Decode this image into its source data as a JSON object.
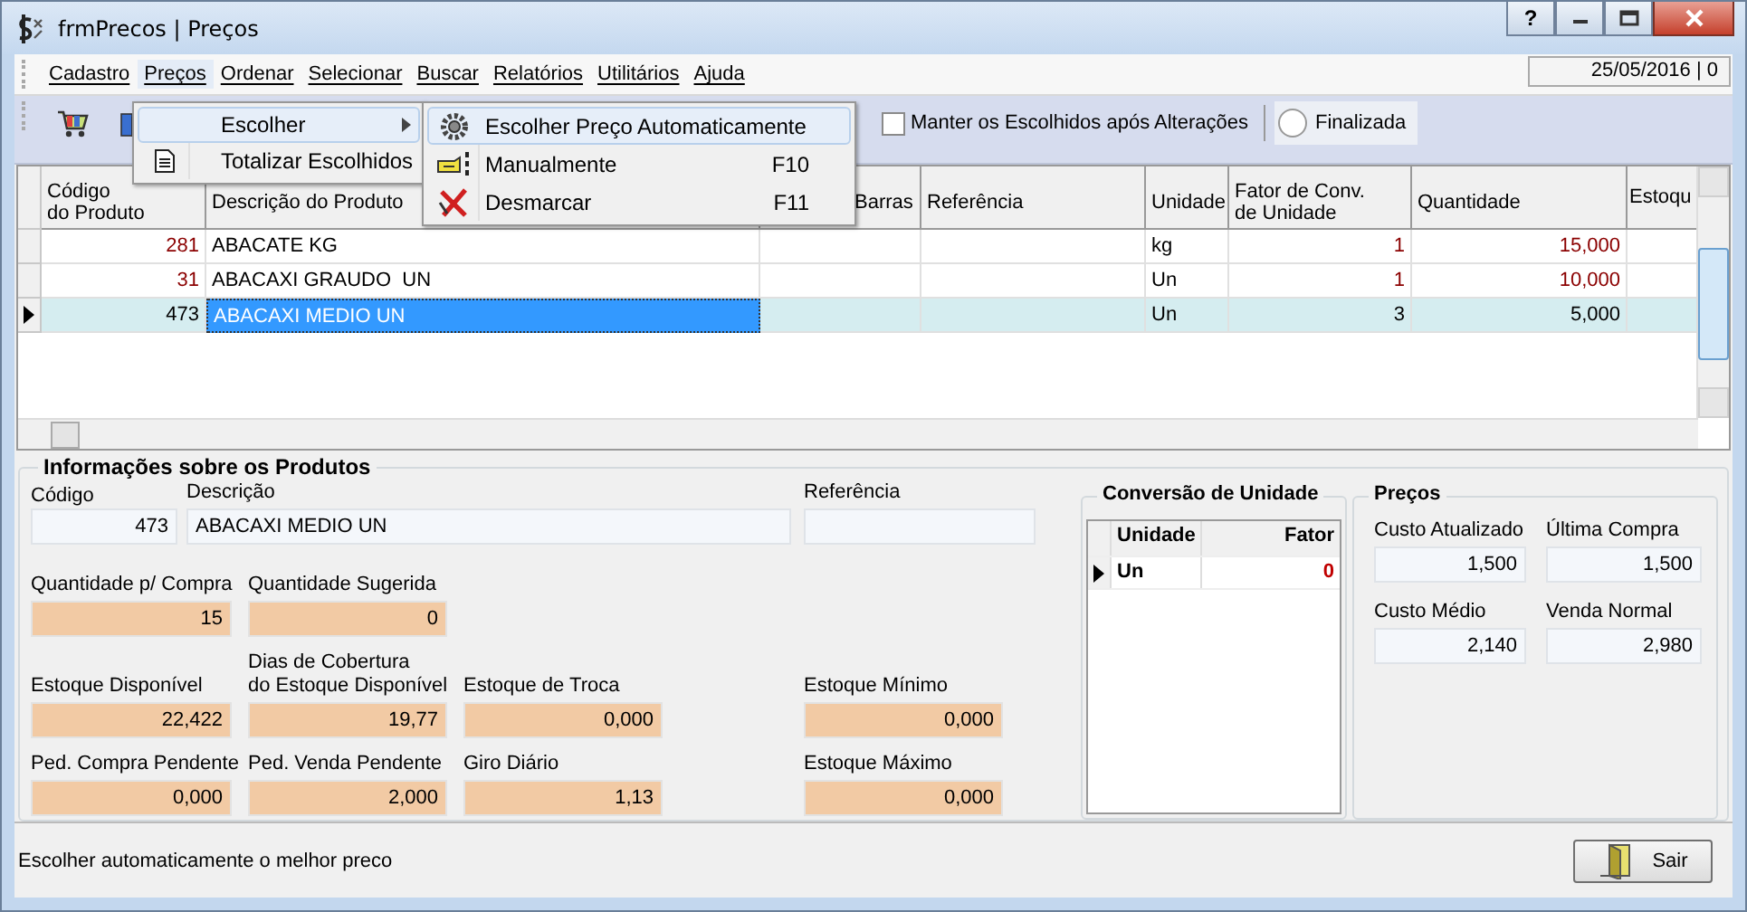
{
  "window": {
    "title": "frmPrecos | Preços",
    "help_button": "?"
  },
  "menu_bar": [
    {
      "label": "Cadastro",
      "selected": false
    },
    {
      "label": "Preços",
      "selected": true
    },
    {
      "label": "Ordenar",
      "selected": false
    },
    {
      "label": "Selecionar",
      "selected": false
    },
    {
      "label": "Buscar",
      "selected": false
    },
    {
      "label": "Relatórios",
      "selected": false
    },
    {
      "label": "Utilitários",
      "selected": false
    },
    {
      "label": "Ajuda",
      "selected": false
    }
  ],
  "date_panel": "25/05/2016 | 0",
  "toolbar": {
    "checkbox": {
      "label": "Manter os Escolhidos após Alterações",
      "checked": false
    },
    "radio": {
      "label": "Finalizada",
      "selected": false
    }
  },
  "grid": {
    "columns": [
      "Código\ndo Produto",
      "Descrição do Produto",
      "Barras",
      "Referência",
      "Unidade",
      "Fator de Conv.\nde Unidade",
      "Quantidade",
      "Estoqu"
    ],
    "rows": [
      {
        "code": "281",
        "description": "ABACATE KG",
        "unit": "kg",
        "factor": "1",
        "quantity": "15,000",
        "selected": false
      },
      {
        "code": "31",
        "description": "ABACAXI GRAUDO  UN",
        "unit": "Un",
        "factor": "1",
        "quantity": "10,000",
        "selected": false
      },
      {
        "code": "473",
        "description": "ABACAXI MEDIO UN",
        "unit": "Un",
        "factor": "3",
        "quantity": "5,000",
        "selected": true
      }
    ]
  },
  "menu": {
    "items": [
      {
        "label": "Escolher",
        "selected": true,
        "submenu": true
      },
      {
        "label": "Totalizar Escolhidos",
        "selected": false,
        "submenu": false
      }
    ]
  },
  "submenu": {
    "items": [
      {
        "label": "Escolher Preço Automaticamente",
        "selected": true
      },
      {
        "label": "Manualmente",
        "shortcut": "F10",
        "selected": false
      },
      {
        "label": "Desmarcar",
        "shortcut": "F11",
        "selected": false
      }
    ]
  },
  "product_info": {
    "title": "Informações sobre os Produtos",
    "fields": [
      {
        "label": "Código",
        "value": "473",
        "kind": "plain"
      },
      {
        "label": "Descrição",
        "value": "ABACAXI MEDIO UN",
        "kind": "plain"
      },
      {
        "label": "Referência",
        "kind": "plain"
      },
      {
        "label": "Quantidade p/ Compra",
        "value": "15",
        "kind": "highlight"
      },
      {
        "label": "Quantidade Sugerida",
        "value": "0",
        "kind": "highlight"
      },
      {
        "label": "Estoque Disponível",
        "value": "22,422",
        "kind": "highlight"
      },
      {
        "label": "Dias de Cobertura\ndo Estoque Disponível",
        "value": "19,77",
        "kind": "highlight"
      },
      {
        "label": "Estoque de Troca",
        "value": "0,000",
        "kind": "highlight"
      },
      {
        "label": "Estoque Mínimo",
        "value": "0,000",
        "kind": "highlight"
      },
      {
        "label": "Ped. Compra Pendente",
        "value": "0,000",
        "kind": "highlight"
      },
      {
        "label": "Ped. Venda Pendente",
        "value": "2,000",
        "kind": "highlight"
      },
      {
        "label": "Giro Diário",
        "value": "1,13",
        "kind": "highlight"
      },
      {
        "label": "Estoque Máximo",
        "value": "0,000",
        "kind": "highlight"
      }
    ]
  },
  "unit_conversion": {
    "title": "Conversão de Unidade",
    "columns": [
      "Unidade",
      "Fator"
    ],
    "rows": [
      {
        "unit": "Un",
        "factor": "0",
        "selected": true
      }
    ]
  },
  "prices": {
    "title": "Preços",
    "fields": [
      {
        "label": "Custo Atualizado",
        "value": "1,500"
      },
      {
        "label": "Última Compra",
        "value": "1,500"
      },
      {
        "label": "Custo Médio",
        "value": "2,140"
      },
      {
        "label": "Venda Normal",
        "value": "2,980"
      }
    ]
  },
  "status_bar": {
    "text": "Escolher automaticamente o melhor preco",
    "button": "Sair"
  }
}
